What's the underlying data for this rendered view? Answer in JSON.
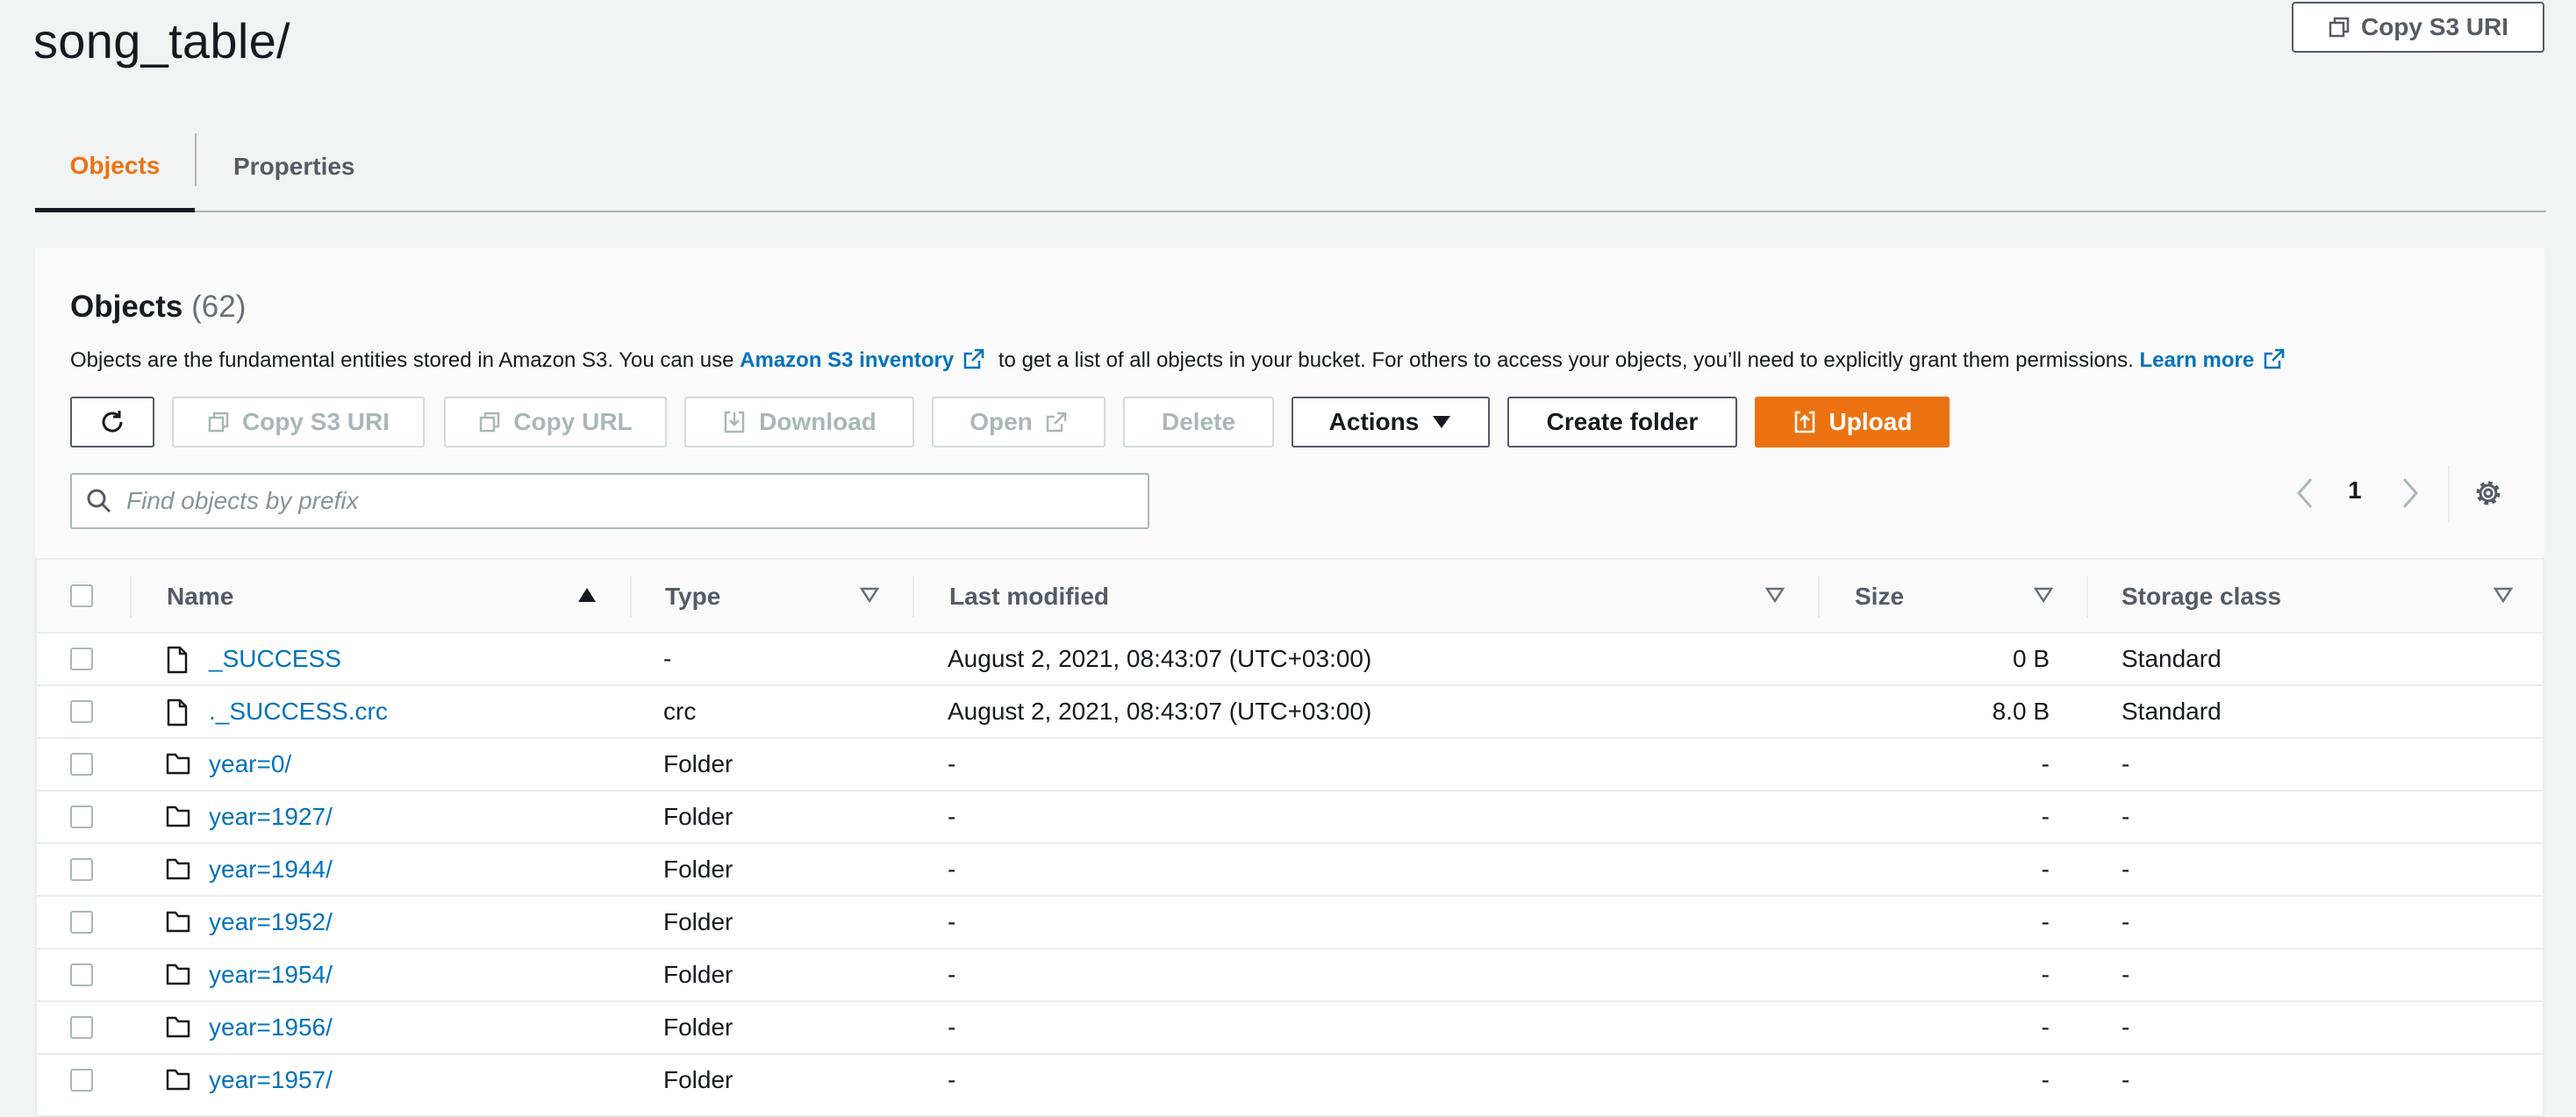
{
  "page": {
    "title": "song_table/",
    "copy_s3_uri_label": "Copy S3 URI"
  },
  "tabs": [
    {
      "label": "Objects",
      "active": true
    },
    {
      "label": "Properties",
      "active": false
    }
  ],
  "panel": {
    "title": "Objects",
    "count": "(62)",
    "description_pre": "Objects are the fundamental entities stored in Amazon S3. You can use ",
    "inventory_link": "Amazon S3 inventory",
    "description_mid": " to get a list of all objects in your bucket. For others to access your objects, you’ll need to explicitly grant them permissions. ",
    "learn_more": "Learn more"
  },
  "toolbar": {
    "copy_s3_uri": "Copy S3 URI",
    "copy_url": "Copy URL",
    "download": "Download",
    "open": "Open",
    "delete": "Delete",
    "actions": "Actions",
    "create_folder": "Create folder",
    "upload": "Upload"
  },
  "search": {
    "placeholder": "Find objects by prefix"
  },
  "pagination": {
    "current_page": "1"
  },
  "table": {
    "columns": {
      "name": "Name",
      "type": "Type",
      "last_modified": "Last modified",
      "size": "Size",
      "storage_class": "Storage class"
    },
    "rows": [
      {
        "kind": "file",
        "name": "_SUCCESS",
        "type": "-",
        "last_modified": "August 2, 2021, 08:43:07 (UTC+03:00)",
        "size": "0 B",
        "storage_class": "Standard"
      },
      {
        "kind": "file",
        "name": "._SUCCESS.crc",
        "type": "crc",
        "last_modified": "August 2, 2021, 08:43:07 (UTC+03:00)",
        "size": "8.0 B",
        "storage_class": "Standard"
      },
      {
        "kind": "folder",
        "name": "year=0/",
        "type": "Folder",
        "last_modified": "-",
        "size": "-",
        "storage_class": "-"
      },
      {
        "kind": "folder",
        "name": "year=1927/",
        "type": "Folder",
        "last_modified": "-",
        "size": "-",
        "storage_class": "-"
      },
      {
        "kind": "folder",
        "name": "year=1944/",
        "type": "Folder",
        "last_modified": "-",
        "size": "-",
        "storage_class": "-"
      },
      {
        "kind": "folder",
        "name": "year=1952/",
        "type": "Folder",
        "last_modified": "-",
        "size": "-",
        "storage_class": "-"
      },
      {
        "kind": "folder",
        "name": "year=1954/",
        "type": "Folder",
        "last_modified": "-",
        "size": "-",
        "storage_class": "-"
      },
      {
        "kind": "folder",
        "name": "year=1956/",
        "type": "Folder",
        "last_modified": "-",
        "size": "-",
        "storage_class": "-"
      },
      {
        "kind": "folder",
        "name": "year=1957/",
        "type": "Folder",
        "last_modified": "-",
        "size": "-",
        "storage_class": "-"
      }
    ]
  },
  "colors": {
    "accent": "#ec7211",
    "link": "#0073bb",
    "text": "#16191f",
    "muted": "#545b64"
  }
}
